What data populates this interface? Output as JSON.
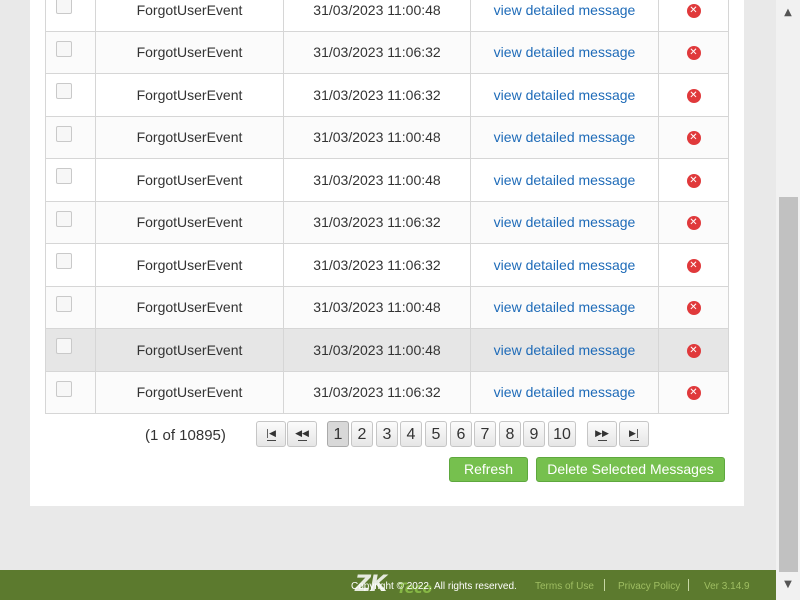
{
  "messages": [
    {
      "event": "ForgotUserEvent",
      "time": "31/03/2023 11:00:48",
      "link": "view detailed message"
    },
    {
      "event": "ForgotUserEvent",
      "time": "31/03/2023 11:06:32",
      "link": "view detailed message"
    },
    {
      "event": "ForgotUserEvent",
      "time": "31/03/2023 11:06:32",
      "link": "view detailed message"
    },
    {
      "event": "ForgotUserEvent",
      "time": "31/03/2023 11:00:48",
      "link": "view detailed message"
    },
    {
      "event": "ForgotUserEvent",
      "time": "31/03/2023 11:00:48",
      "link": "view detailed message"
    },
    {
      "event": "ForgotUserEvent",
      "time": "31/03/2023 11:06:32",
      "link": "view detailed message"
    },
    {
      "event": "ForgotUserEvent",
      "time": "31/03/2023 11:06:32",
      "link": "view detailed message"
    },
    {
      "event": "ForgotUserEvent",
      "time": "31/03/2023 11:00:48",
      "link": "view detailed message"
    },
    {
      "event": "ForgotUserEvent",
      "time": "31/03/2023 11:00:48",
      "link": "view detailed message"
    },
    {
      "event": "ForgotUserEvent",
      "time": "31/03/2023 11:06:32",
      "link": "view detailed message"
    }
  ],
  "pagination": {
    "info": "(1 of 10895)",
    "first_icon": "first-page-icon",
    "prev_icon": "previous-page-icon",
    "next_icon": "next-page-icon",
    "last_icon": "last-page-icon",
    "pages": [
      "1",
      "2",
      "3",
      "4",
      "5",
      "6",
      "7",
      "8",
      "9",
      "10"
    ],
    "current_page": "1"
  },
  "actions": {
    "refresh": "Refresh",
    "delete_selected": "Delete Selected Messages"
  },
  "footer": {
    "logo_main": "ZK",
    "logo_sub": "Teco",
    "copyright": "Copyright © 2022. All rights reserved.",
    "terms": "Terms of Use",
    "privacy": "Privacy Policy",
    "version": "Ver 3.14.9"
  },
  "colors": {
    "footer_bg": "#5c7a2e",
    "button_green": "#76c04e",
    "link_blue": "#1e6bb8",
    "delete_red": "#e0393b",
    "highlight_row": "#e6e6e6"
  },
  "icons": {
    "delete": "delete-x-icon",
    "scroll_up": "scroll-up-arrow-icon",
    "scroll_down": "scroll-down-arrow-icon"
  }
}
